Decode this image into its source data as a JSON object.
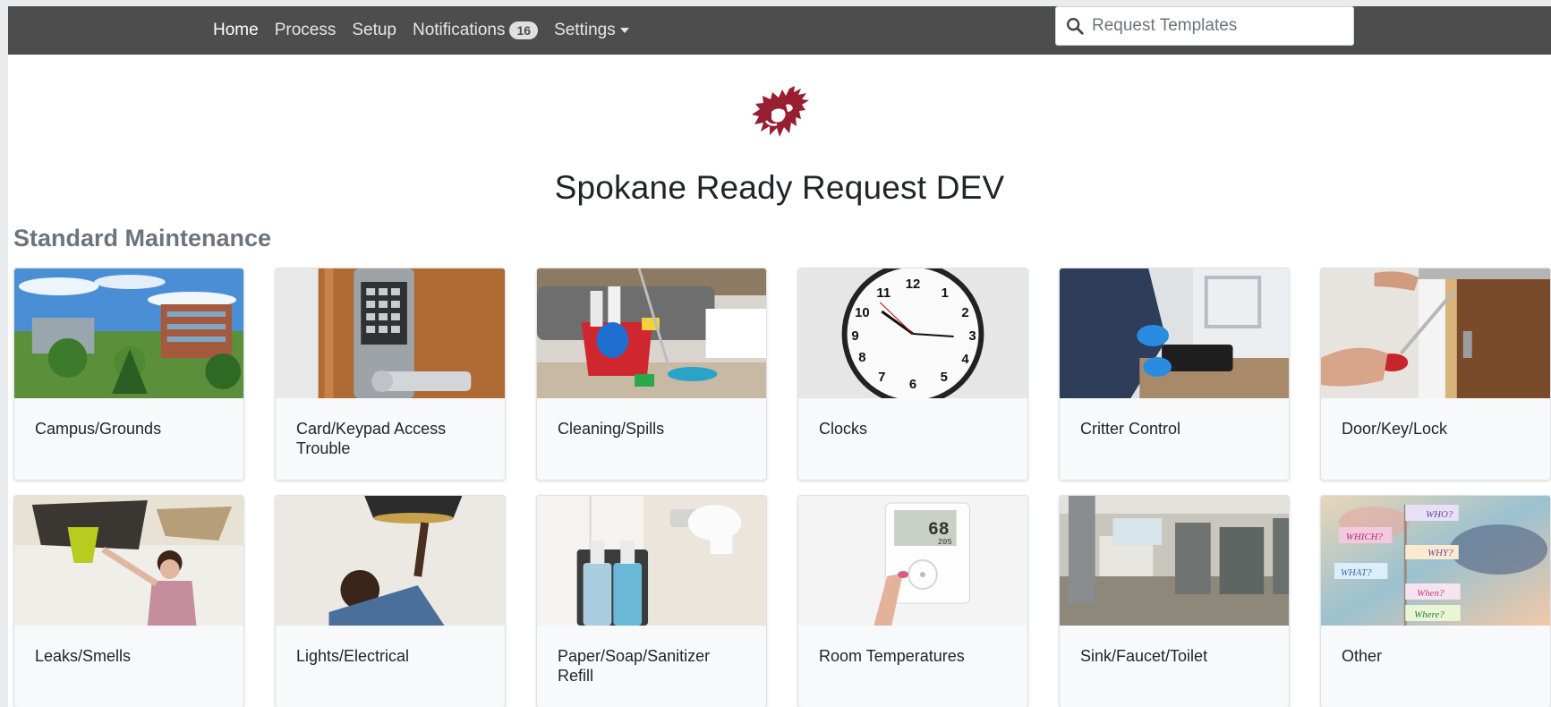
{
  "navbar": {
    "items": [
      {
        "label": "Home",
        "active": true
      },
      {
        "label": "Process"
      },
      {
        "label": "Setup"
      },
      {
        "label": "Notifications",
        "badge": "16"
      },
      {
        "label": "Settings",
        "dropdown": true
      }
    ],
    "search": {
      "placeholder": "Request Templates",
      "icon": "search-icon"
    }
  },
  "logo": {
    "name": "wsu-cougar-logo",
    "color": "#981e32"
  },
  "page_title": "Spokane Ready Request DEV",
  "section_title": "Standard Maintenance",
  "cards": [
    {
      "label": "Campus/Grounds",
      "image": "campus-grounds-photo"
    },
    {
      "label": "Card/Keypad Access Trouble",
      "image": "keypad-lock-photo"
    },
    {
      "label": "Cleaning/Spills",
      "image": "cleaning-supplies-photo"
    },
    {
      "label": "Clocks",
      "image": "wall-clock-photo"
    },
    {
      "label": "Critter Control",
      "image": "pest-trap-photo"
    },
    {
      "label": "Door/Key/Lock",
      "image": "door-lock-repair-photo"
    },
    {
      "label": "Leaks/Smells",
      "image": "ceiling-leak-photo"
    },
    {
      "label": "Lights/Electrical",
      "image": "light-fixture-photo"
    },
    {
      "label": "Paper/Soap/Sanitizer Refill",
      "image": "soap-dispenser-photo"
    },
    {
      "label": "Room Temperatures",
      "image": "thermostat-photo",
      "thermostat_reading": "68",
      "thermostat_sub": "205"
    },
    {
      "label": "Sink/Faucet/Toilet",
      "image": "restroom-photo"
    },
    {
      "label": "Other",
      "image": "question-signs-photo",
      "signs": [
        "WHO?",
        "WHICH?",
        "WHY?",
        "WHAT?",
        "When?",
        "Where?"
      ]
    }
  ]
}
